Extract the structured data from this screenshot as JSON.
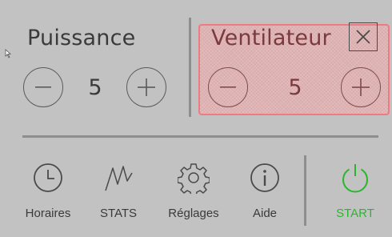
{
  "power": {
    "title": "Puissance",
    "value": "5",
    "minus_symbol": "−",
    "plus_symbol": "+"
  },
  "fan": {
    "title": "Ventilateur",
    "value": "5",
    "minus_symbol": "−",
    "plus_symbol": "+",
    "highlight_color": "#f07a82"
  },
  "close_symbol": "✕",
  "nav": [
    {
      "label": "Horaires",
      "icon": "clock-icon"
    },
    {
      "label": "STATS",
      "icon": "zigzag-chart-icon"
    },
    {
      "label": "Réglages",
      "icon": "gear-icon"
    },
    {
      "label": "Aide",
      "icon": "info-icon"
    },
    {
      "label": "START",
      "icon": "power-icon",
      "color": "#2bb52f"
    }
  ],
  "colors": {
    "background": "#c3c2c3",
    "separator": "#8e8d8f",
    "text": "#3a3a3a",
    "start": "#2bb52f"
  }
}
